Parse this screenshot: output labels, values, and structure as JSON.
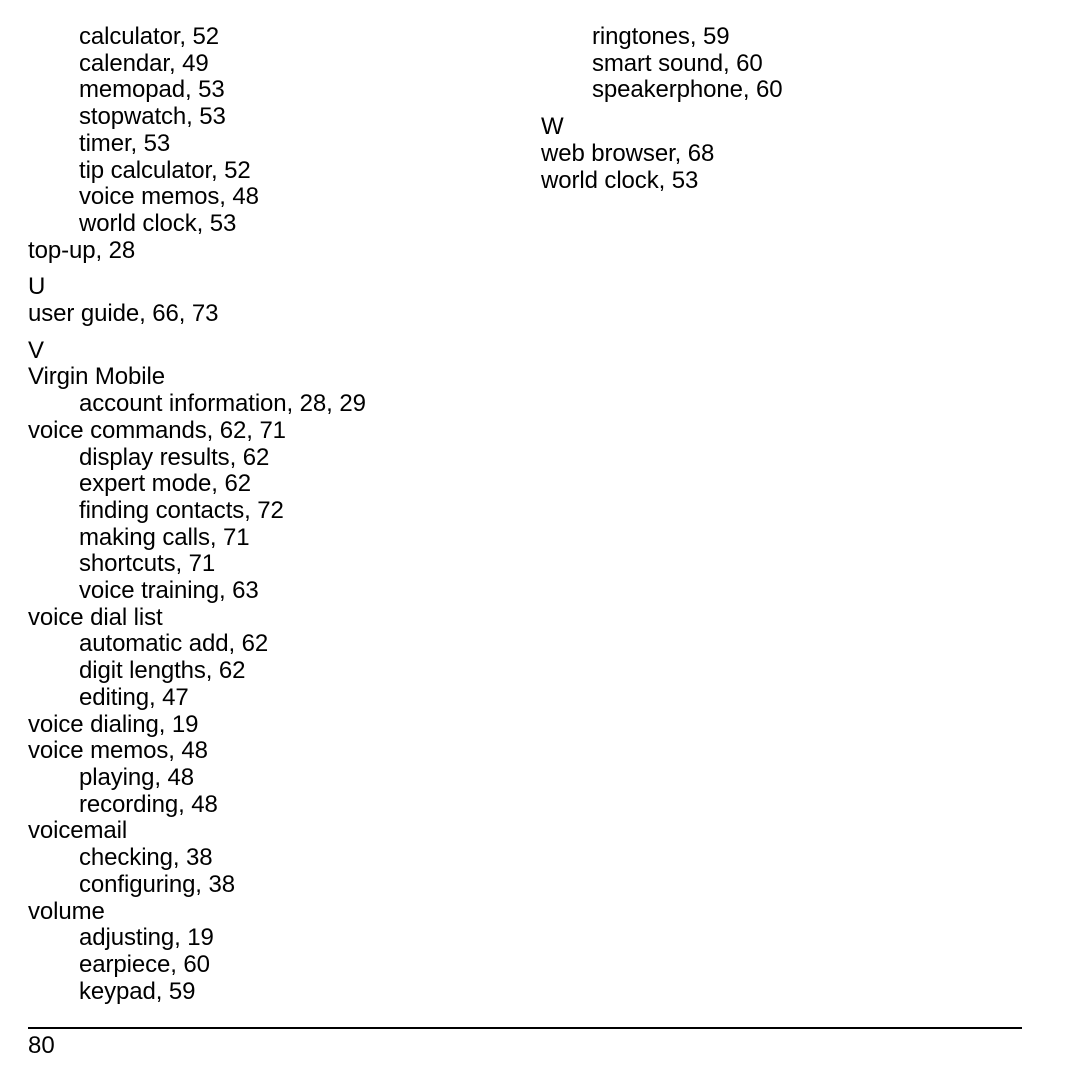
{
  "document": {
    "type": "index",
    "page_number": "80"
  },
  "columns": [
    {
      "name": "left-column",
      "entries": [
        {
          "level": 1,
          "text": "calculator, 52"
        },
        {
          "level": 1,
          "text": "calendar, 49"
        },
        {
          "level": 1,
          "text": "memopad, 53"
        },
        {
          "level": 1,
          "text": "stopwatch, 53"
        },
        {
          "level": 1,
          "text": "timer, 53"
        },
        {
          "level": 1,
          "text": "tip calculator, 52"
        },
        {
          "level": 1,
          "text": "voice memos, 48"
        },
        {
          "level": 1,
          "text": "world clock, 53"
        },
        {
          "level": 0,
          "text": "top-up, 28"
        },
        {
          "level": 0,
          "text": "U",
          "letter": true
        },
        {
          "level": 0,
          "text": "user guide, 66, 73"
        },
        {
          "level": 0,
          "text": "V",
          "letter": true
        },
        {
          "level": 0,
          "text": "Virgin Mobile"
        },
        {
          "level": 1,
          "text": "account information, 28, 29"
        },
        {
          "level": 0,
          "text": "voice commands, 62, 71"
        },
        {
          "level": 1,
          "text": "display results, 62"
        },
        {
          "level": 1,
          "text": "expert mode, 62"
        },
        {
          "level": 1,
          "text": "finding contacts, 72"
        },
        {
          "level": 1,
          "text": "making calls, 71"
        },
        {
          "level": 1,
          "text": "shortcuts, 71"
        },
        {
          "level": 1,
          "text": "voice training, 63"
        },
        {
          "level": 0,
          "text": "voice dial list"
        },
        {
          "level": 1,
          "text": "automatic add, 62"
        },
        {
          "level": 1,
          "text": "digit lengths, 62"
        },
        {
          "level": 1,
          "text": "editing, 47"
        },
        {
          "level": 0,
          "text": "voice dialing, 19"
        },
        {
          "level": 0,
          "text": "voice memos, 48"
        },
        {
          "level": 1,
          "text": "playing, 48"
        },
        {
          "level": 1,
          "text": "recording, 48"
        },
        {
          "level": 0,
          "text": "voicemail"
        },
        {
          "level": 1,
          "text": "checking, 38"
        },
        {
          "level": 1,
          "text": "configuring, 38"
        },
        {
          "level": 0,
          "text": "volume"
        },
        {
          "level": 1,
          "text": "adjusting, 19"
        },
        {
          "level": 1,
          "text": "earpiece, 60"
        },
        {
          "level": 1,
          "text": "keypad, 59"
        }
      ]
    },
    {
      "name": "right-column",
      "entries": [
        {
          "level": 1,
          "text": "ringtones, 59"
        },
        {
          "level": 1,
          "text": "smart sound, 60"
        },
        {
          "level": 1,
          "text": "speakerphone, 60"
        },
        {
          "level": 0,
          "text": "W",
          "letter": true
        },
        {
          "level": 0,
          "text": "web browser, 68"
        },
        {
          "level": 0,
          "text": "world clock, 53"
        }
      ]
    }
  ]
}
